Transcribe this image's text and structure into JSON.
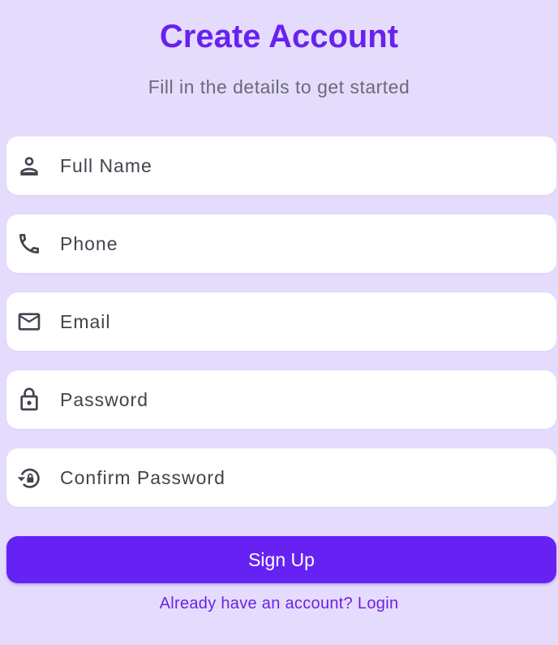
{
  "header": {
    "title": "Create Account",
    "subtitle": "Fill in the details to get started"
  },
  "form": {
    "fields": [
      {
        "icon": "person-icon",
        "placeholder": "Full Name",
        "value": ""
      },
      {
        "icon": "phone-icon",
        "placeholder": "Phone",
        "value": ""
      },
      {
        "icon": "mail-icon",
        "placeholder": "Email",
        "value": ""
      },
      {
        "icon": "lock-icon",
        "placeholder": "Password",
        "value": ""
      },
      {
        "icon": "lock-reset-icon",
        "placeholder": "Confirm Password",
        "value": ""
      }
    ],
    "submit_label": "Sign Up",
    "login_text": "Already have an account? Login"
  },
  "colors": {
    "background": "#e5dcfd",
    "accent": "#6622f3",
    "title": "#6722f0",
    "field_background": "#ffffff",
    "icon": "#45434f"
  }
}
